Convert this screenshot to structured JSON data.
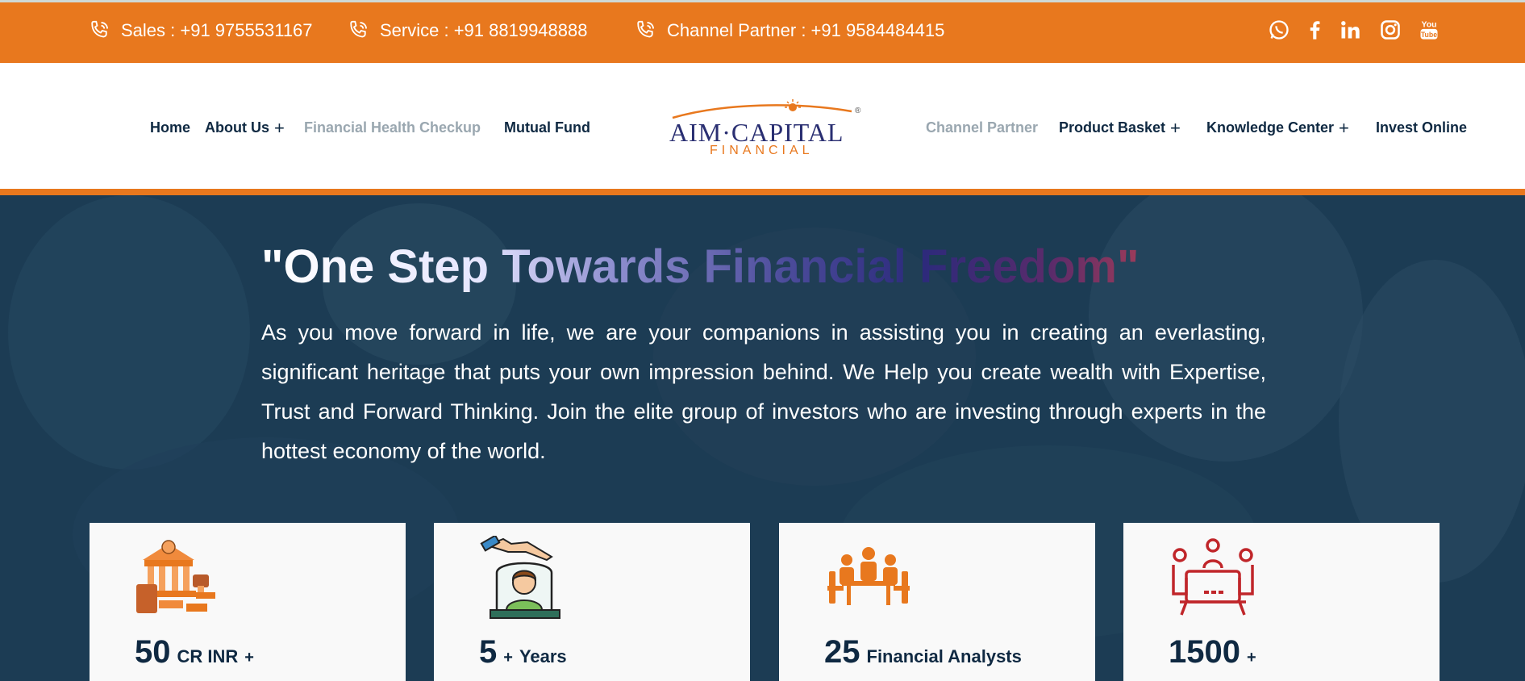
{
  "topbar": {
    "contacts": [
      {
        "label": "Sales : +91 9755531167"
      },
      {
        "label": "Service : +91 8819948888"
      },
      {
        "label": "Channel Partner : +91 9584484415"
      }
    ],
    "social": [
      "whatsapp-icon",
      "facebook-icon",
      "linkedin-icon",
      "instagram-icon",
      "youtube-icon"
    ],
    "youtube_text": "You Tube"
  },
  "nav": {
    "home": "Home",
    "about": "About Us",
    "health": "Financial Health Checkup",
    "mutual": "Mutual Fund",
    "channel": "Channel Partner",
    "product": "Product Basket",
    "knowledge": "Knowledge Center",
    "invest": "Invest Online",
    "plus": "+"
  },
  "logo": {
    "main": "AIM·CAPITAL",
    "sub": "FINANCIAL",
    "mark": "®"
  },
  "hero": {
    "headline": "\"One Step Towards Financial Freedom\"",
    "paragraph": "As you move forward in life, we are your companions in assisting you in creating an everlasting, significant heritage that puts your own impression behind. We Help you create wealth with Expertise, Trust and Forward Thinking. Join the elite group of investors who are investing through experts in the hottest economy of the world."
  },
  "stats": [
    {
      "num": "50",
      "unit": "CR INR",
      "plus": "+"
    },
    {
      "num": "5",
      "unit": "Years",
      "plus": "+"
    },
    {
      "num": "25",
      "unit": "Financial Analysts",
      "plus": ""
    },
    {
      "num": "1500",
      "unit": "",
      "plus": "+"
    }
  ],
  "colors": {
    "accent": "#e8781e",
    "navy": "#0f2942",
    "hero": "#1a3a52"
  }
}
